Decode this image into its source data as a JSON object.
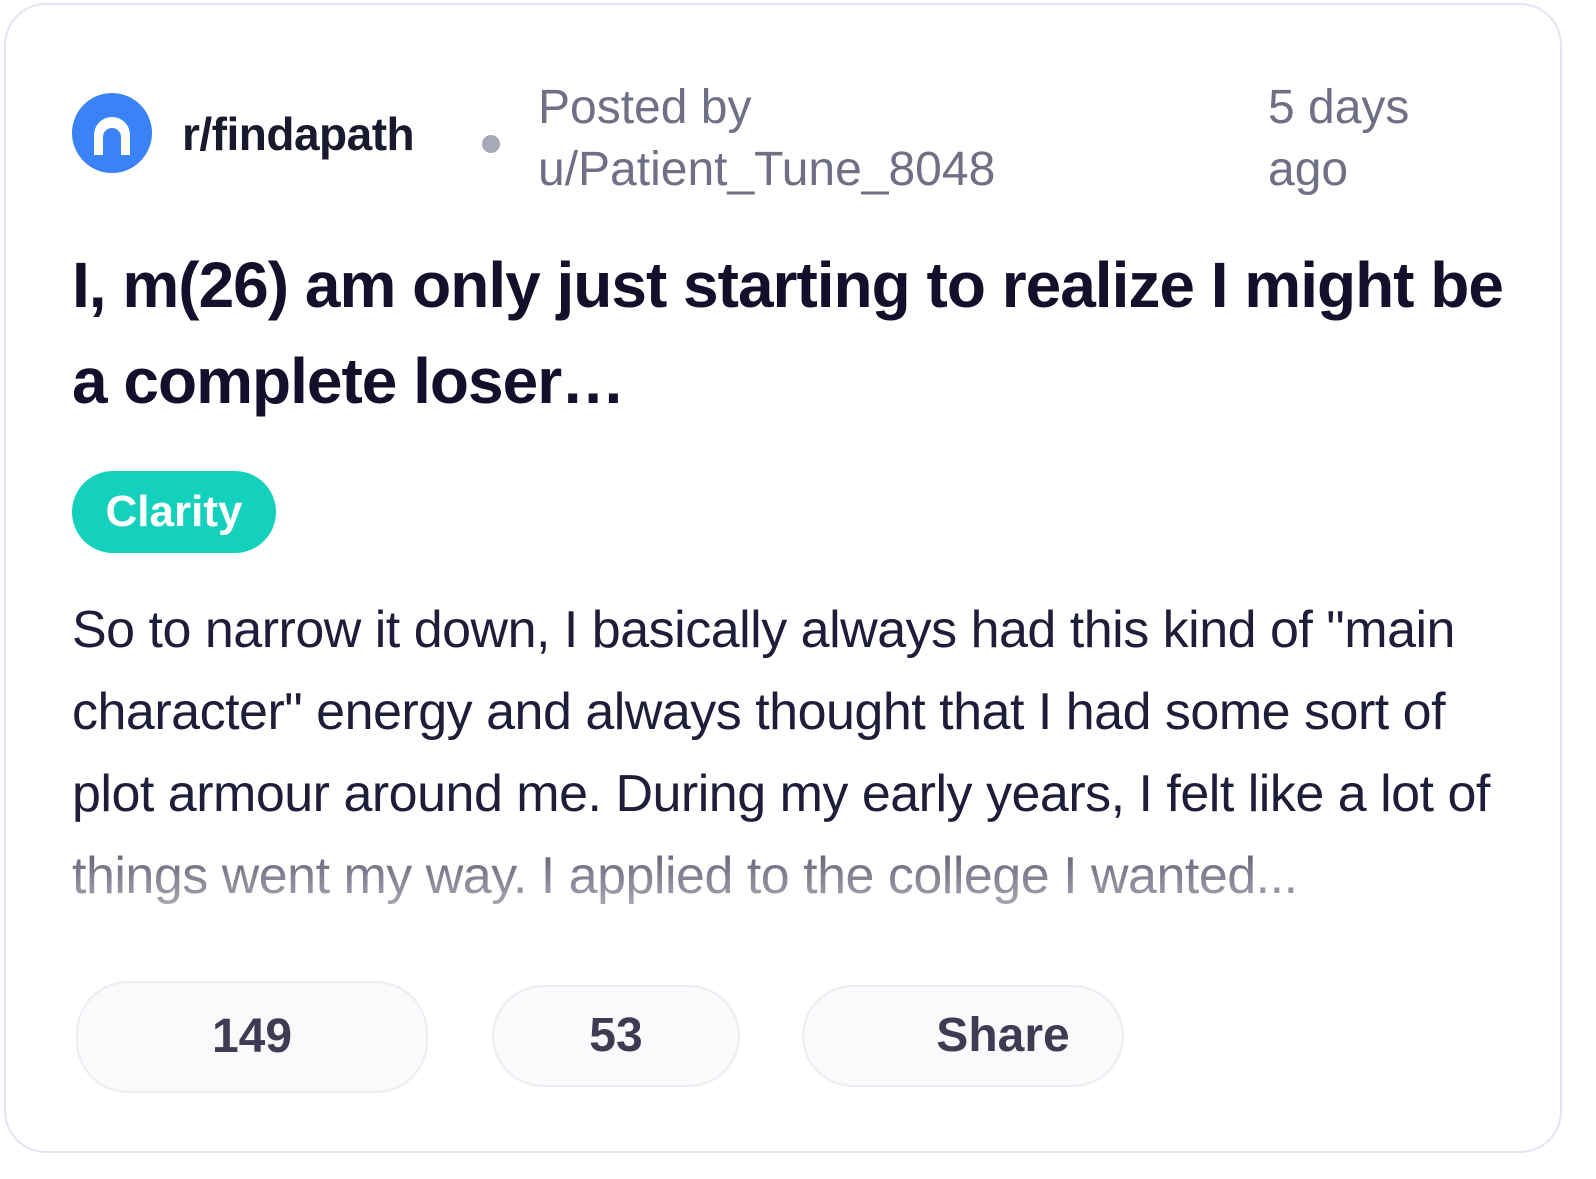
{
  "post": {
    "subreddit": "r/findapath",
    "posted_by_prefix": "Posted by",
    "username": "u/Patient_Tune_8048",
    "time_ago": "5 days ago",
    "title": "I, m(26) am only just starting to realize I might be a complete loser…",
    "flair": "Clarity",
    "body": "So to narrow it down, I basically always had this kind of \"main character\" energy and always thought that I had some sort of plot armour around me. During my early years, I felt like a lot of things went my way. I applied to the college I wanted..."
  },
  "actions": {
    "upvotes": "149",
    "comments": "53",
    "share_label": "Share"
  },
  "colors": {
    "subreddit_icon": "#3b82f6",
    "flair_background": "#14d1bd",
    "title_text": "#12102b",
    "meta_text": "#6f7085"
  },
  "icons": {
    "subreddit": "subreddit-logo-icon"
  }
}
